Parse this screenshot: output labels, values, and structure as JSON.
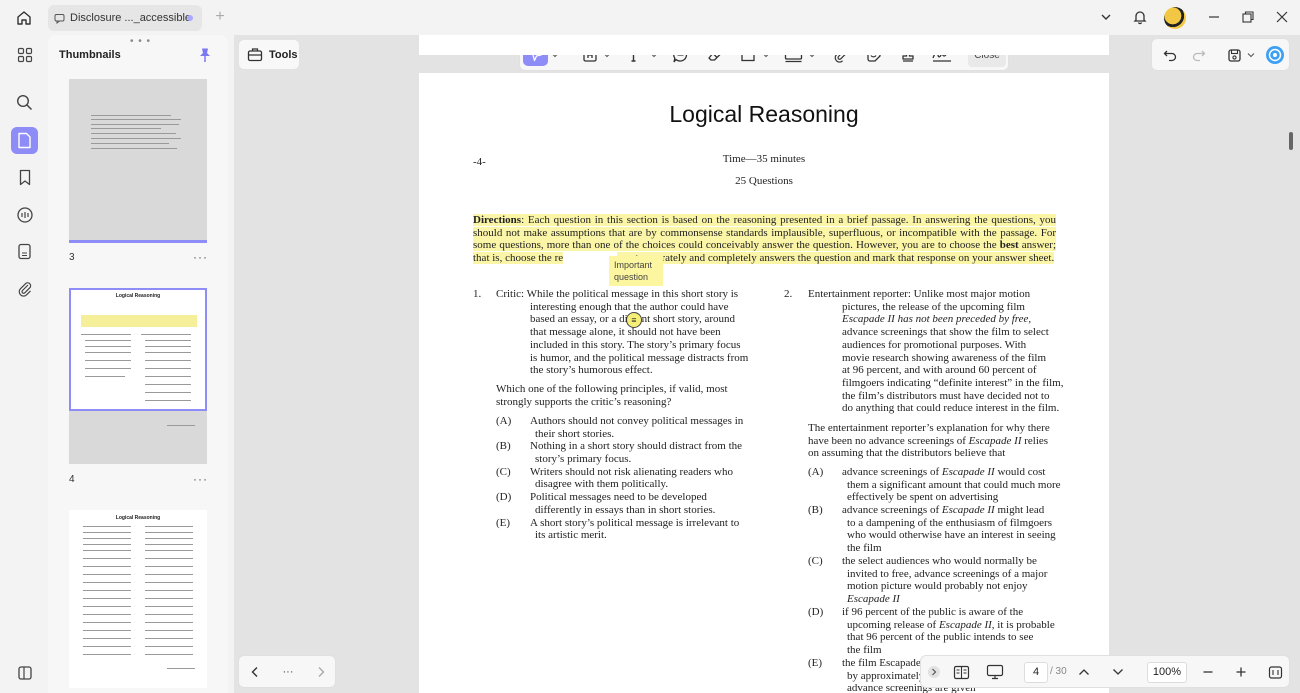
{
  "tab": {
    "title": "Disclosure ..._accessible"
  },
  "sidebar": {
    "title": "Thumbnails",
    "thumbs": [
      {
        "page": "3"
      },
      {
        "page": "4"
      }
    ],
    "more": "···"
  },
  "tools": {
    "label": "Tools"
  },
  "toolbar": {
    "close_label": "Close"
  },
  "document": {
    "page_marker": "-4-",
    "title": "Logical Reasoning",
    "time": "Time—35 minutes",
    "question_count": "25 Questions",
    "directions_label": "Directions",
    "directions_a": ": Each question in this section is based on the reasoning presented in a brief passage. In answering the questions, you should not make assumptions that are by commonsense standards implausible, superfluous, or incompatible with the passage. For some questions, more than one of the choices could conceivably answer the question. However, you are to choose the ",
    "directions_bold": "best",
    "directions_b": " answer; that is, choose the re",
    "directions_c": "most accurately and completely answers the question and mark that response on your answer sheet.",
    "sticky_note": "Important question",
    "q1": {
      "num": "1.",
      "l1": "Critic: While the political message in this short story is",
      "body": [
        "interesting enough that the author could have",
        "based an essay, or a di",
        "that message alone, it should not have been",
        "included in this story. The story’s primary focus",
        "is humor, and the political message distracts from",
        "the story’s humorous effect."
      ],
      "body_1b": "nt short story, around",
      "stem1": "Which one of the following principles, if valid, most",
      "stem2": "strongly supports the critic’s reasoning?",
      "options": [
        {
          "l": "(A)",
          "a": "Authors should not convey political messages in",
          "b": "their short stories."
        },
        {
          "l": "(B)",
          "a": "Nothing in a short story should distract from the",
          "b": "story’s primary focus."
        },
        {
          "l": "(C)",
          "a": "Writers should not risk alienating readers who",
          "b": "disagree with them politically."
        },
        {
          "l": "(D)",
          "a": "Political messages need to be developed",
          "b": "differently in essays than in short stories."
        },
        {
          "l": "(E)",
          "a": "A short story’s political message is irrelevant to",
          "b": "its artistic merit."
        }
      ]
    },
    "q2": {
      "num": "2.",
      "l1": "Entertainment reporter: Unlike most major motion",
      "body": [
        "pictures, the release of the upcoming film",
        "Escapade II has not been preceded by free,",
        "advance screenings that show the film to select",
        "audiences for promotional purposes. With",
        "movie research showing awareness of the film",
        "at 96 percent, and with around 60 percent of",
        "filmgoers indicating “definite interest” in the film,",
        "the film’s distributors must have decided not to",
        "do anything that could reduce interest in the film."
      ],
      "stem1": "The entertainment reporter’s explanation for why there",
      "stem2": "have been no advance screenings of Escapade II relies",
      "stem3": "on assuming that the distributors believe that",
      "options": [
        {
          "l": "(A)",
          "lines": [
            "advance screenings of Escapade II would cost",
            "them a significant amount that could much more",
            "effectively be spent on advertising"
          ]
        },
        {
          "l": "(B)",
          "lines": [
            "advance screenings of Escapade II might lead",
            "to a dampening of the enthusiasm of filmgoers",
            "who would otherwise have an interest in seeing",
            "the film"
          ]
        },
        {
          "l": "(C)",
          "lines": [
            "the select audiences who would normally be",
            "invited to free, advance screenings of a major",
            "motion picture would probably not enjoy",
            "Escapade II"
          ]
        },
        {
          "l": "(D)",
          "lines": [
            "if 96 percent of the public is aware of the",
            "upcoming release of Escapade II, it is probable",
            "that 96 percent of the public intends to see",
            "the film"
          ]
        },
        {
          "l": "(E)",
          "lines": [
            "the film Escapade",
            "by approximately",
            "advance screenings are given"
          ]
        }
      ]
    },
    "thumb_page_title": "Logical Reasoning"
  },
  "navigation": {
    "current_page": "4",
    "total_pages": "/ 30",
    "zoom": "100%",
    "more": "···"
  },
  "colors": {
    "accent": "#8e8cf6",
    "highlight": "#fbf5a8"
  }
}
